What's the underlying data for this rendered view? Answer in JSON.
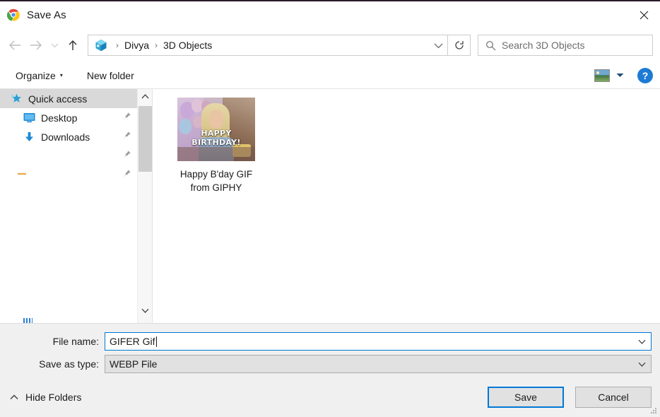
{
  "window": {
    "title": "Save As",
    "app_icon": "chrome-icon",
    "close_label": "✕"
  },
  "nav": {
    "back_icon": "arrow-left-icon",
    "forward_icon": "arrow-right-icon",
    "recent_icon": "chevron-down-icon",
    "up_icon": "arrow-up-icon",
    "breadcrumb": {
      "folder_icon": "3d-objects-cube-icon",
      "items": [
        "Divya",
        "3D Objects"
      ],
      "separator": "›",
      "dropdown_icon": "chevron-down-icon"
    },
    "refresh_icon": "refresh-icon",
    "search": {
      "icon": "search-icon",
      "placeholder": "Search 3D Objects",
      "value": ""
    }
  },
  "toolbar": {
    "organize_label": "Organize",
    "organize_caret": "▾",
    "new_folder_label": "New folder",
    "view_icon": "large-icons-view-icon",
    "view_caret": "▼",
    "help_label": "?"
  },
  "sidebar": {
    "items": [
      {
        "label": "Quick access",
        "icon": "quick-access-star-icon",
        "selected": true,
        "pinned": false,
        "indent": false
      },
      {
        "label": "Desktop",
        "icon": "desktop-monitor-icon",
        "selected": false,
        "pinned": true,
        "indent": true
      },
      {
        "label": "Downloads",
        "icon": "downloads-arrow-icon",
        "selected": false,
        "pinned": true,
        "indent": true
      },
      {
        "label": "",
        "icon": "",
        "selected": false,
        "pinned": true,
        "indent": true
      },
      {
        "label": "",
        "icon": "",
        "selected": false,
        "pinned": true,
        "indent": true
      }
    ],
    "clipped_item_label": "",
    "scrollbar": {
      "up_icon": "chevron-up-icon",
      "down_icon": "chevron-down-icon"
    }
  },
  "files": {
    "items": [
      {
        "name": "Happy B'day GIF from GIPHY",
        "thumbnail_text_line1": "HAPPY",
        "thumbnail_text_line2": "BIRTHDAY!",
        "thumbnail_kind": "gif-thumbnail"
      }
    ]
  },
  "form": {
    "file_name_label": "File name:",
    "file_name_value": "GIFER Gif",
    "file_name_dropdown_icon": "chevron-down-icon",
    "save_as_type_label": "Save as type:",
    "save_as_type_value": "WEBP File",
    "save_as_type_dropdown_icon": "chevron-down-icon"
  },
  "footer": {
    "hide_folders_label": "Hide Folders",
    "hide_folders_icon": "chevron-up-icon",
    "save_label": "Save",
    "cancel_label": "Cancel",
    "resize_grip_icon": "resize-grip-icon"
  },
  "colors": {
    "accent": "#0078d7",
    "selection": "#d9d9d9",
    "panel": "#f0f0f0",
    "help_blue": "#1e7bd4"
  }
}
